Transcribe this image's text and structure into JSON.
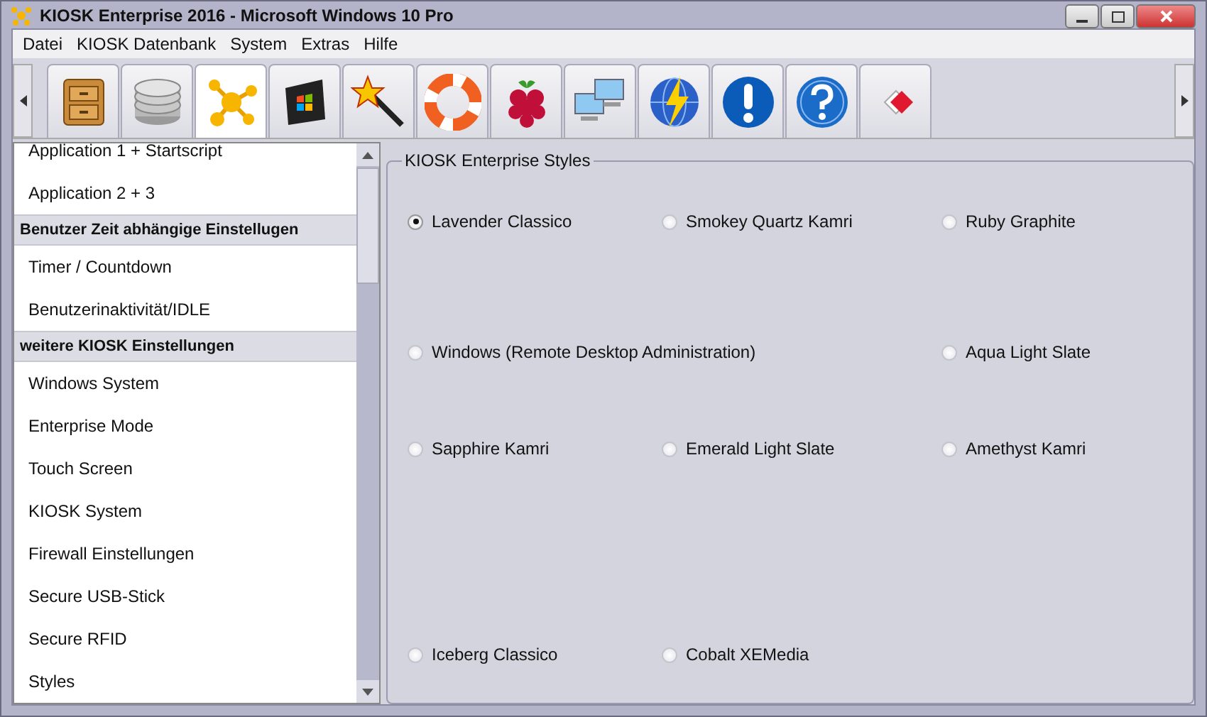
{
  "window": {
    "title": "KIOSK Enterprise 2016 - Microsoft Windows 10 Pro"
  },
  "menu": [
    "Datei",
    "KIOSK Datenbank",
    "System",
    "Extras",
    "Hilfe"
  ],
  "toolbar_tabs": [
    {
      "kind": "cabinet",
      "selected": false
    },
    {
      "kind": "database",
      "selected": false
    },
    {
      "kind": "molecule",
      "selected": true
    },
    {
      "kind": "windows",
      "selected": false
    },
    {
      "kind": "wand",
      "selected": false
    },
    {
      "kind": "lifebuoy",
      "selected": false
    },
    {
      "kind": "raspberry",
      "selected": false
    },
    {
      "kind": "network",
      "selected": false
    },
    {
      "kind": "globe",
      "selected": false
    },
    {
      "kind": "exclamation",
      "selected": false
    },
    {
      "kind": "question",
      "selected": false
    },
    {
      "kind": "diamond",
      "selected": false
    }
  ],
  "sidebar": {
    "items": [
      {
        "kind": "item",
        "label": "Application 1 + Startscript"
      },
      {
        "kind": "item",
        "label": "Application 2 + 3"
      },
      {
        "kind": "header",
        "label": "Benutzer Zeit abhängige Einstellugen"
      },
      {
        "kind": "item",
        "label": "Timer / Countdown"
      },
      {
        "kind": "item",
        "label": "Benutzerinaktivität/IDLE"
      },
      {
        "kind": "header",
        "label": "weitere KIOSK Einstellungen"
      },
      {
        "kind": "item",
        "label": "Windows System"
      },
      {
        "kind": "item",
        "label": "Enterprise Mode"
      },
      {
        "kind": "item",
        "label": "Touch Screen"
      },
      {
        "kind": "item",
        "label": "KIOSK System"
      },
      {
        "kind": "item",
        "label": "Firewall Einstellungen"
      },
      {
        "kind": "item",
        "label": "Secure USB-Stick"
      },
      {
        "kind": "item",
        "label": "Secure RFID"
      },
      {
        "kind": "item",
        "label": "Styles"
      }
    ]
  },
  "styles_group": {
    "title": "KIOSK Enterprise Styles",
    "rows": [
      [
        {
          "label": "Lavender Classico",
          "selected": true
        },
        {
          "label": "Smokey Quartz Kamri",
          "selected": false
        },
        {
          "label": "Ruby Graphite",
          "selected": false
        }
      ],
      [
        {
          "label": "Windows (Remote Desktop Administration)",
          "selected": false
        },
        "",
        {
          "label": "Aqua Light Slate",
          "selected": false
        }
      ],
      [
        {
          "label": "Sapphire Kamri",
          "selected": false
        },
        {
          "label": "Emerald Light Slate",
          "selected": false
        },
        {
          "label": "Amethyst Kamri",
          "selected": false
        }
      ],
      [
        {
          "label": "Iceberg Classico",
          "selected": false
        },
        {
          "label": "Cobalt XEMedia",
          "selected": false
        }
      ]
    ]
  }
}
